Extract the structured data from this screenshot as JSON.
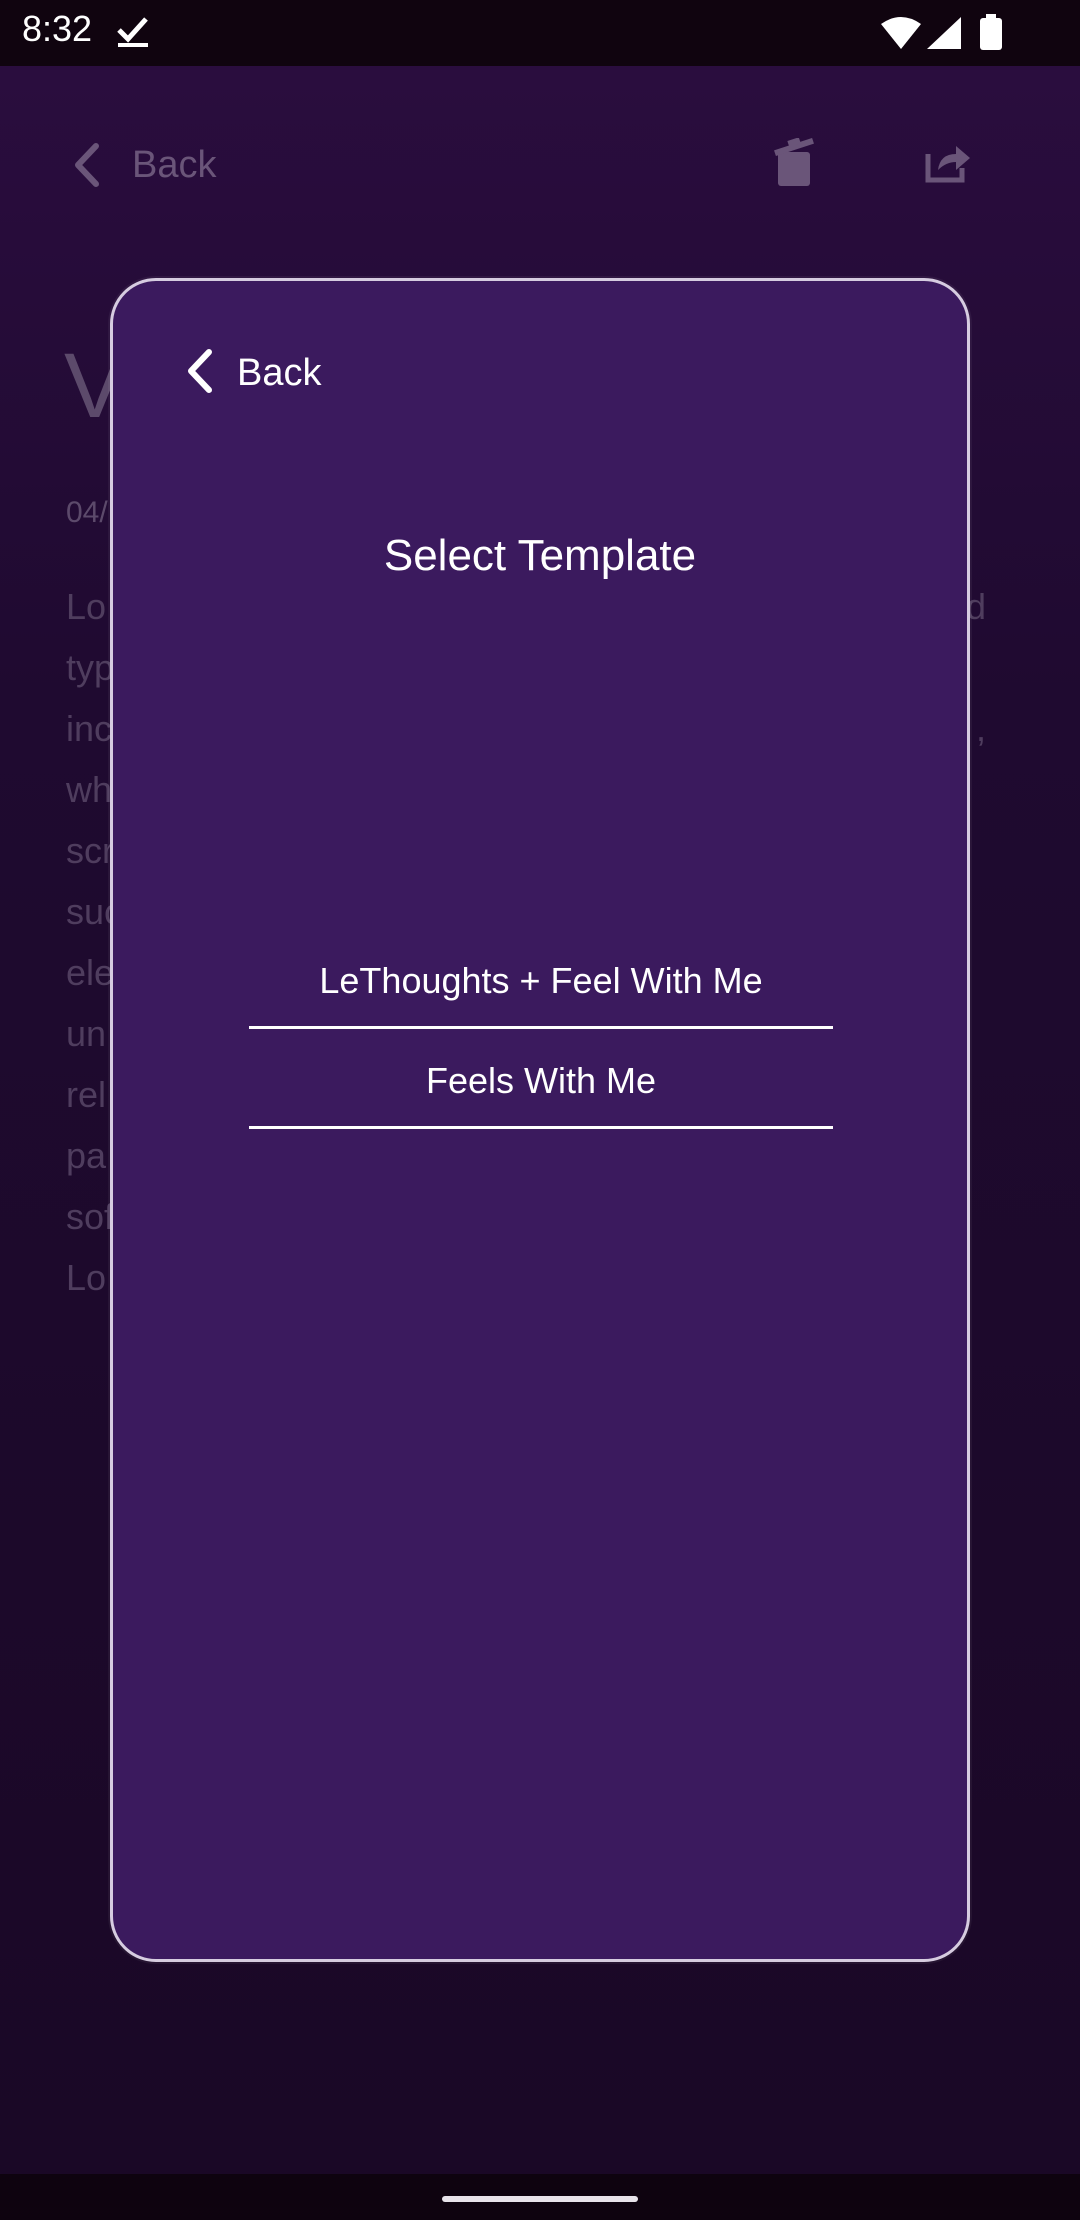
{
  "status_bar": {
    "time": "8:32"
  },
  "background_screen": {
    "back_label": "Back",
    "title": "V",
    "date": "04/",
    "body_lines": [
      {
        "left": "Lo",
        "right": "d"
      },
      {
        "left": "typ",
        "right": ""
      },
      {
        "left": "inc",
        "right": ","
      },
      {
        "left": "wh",
        "right": ""
      },
      {
        "left": "scr",
        "right": ""
      },
      {
        "left": "suc",
        "right": ""
      },
      {
        "left": "ele",
        "right": ""
      },
      {
        "left": "un",
        "right": ""
      },
      {
        "left": "rel",
        "right": ""
      },
      {
        "left": "pa",
        "right": ""
      },
      {
        "left": "sof",
        "right": ""
      },
      {
        "left": "Lo",
        "right": ""
      }
    ]
  },
  "modal": {
    "back_label": "Back",
    "title": "Select Template",
    "options": [
      "LeThoughts + Feel With Me",
      "Feels With Me"
    ]
  },
  "colors": {
    "modal_bg": "#3b1a5e",
    "modal_border": "#d6cce0",
    "screen_bg": "#1a0826"
  }
}
